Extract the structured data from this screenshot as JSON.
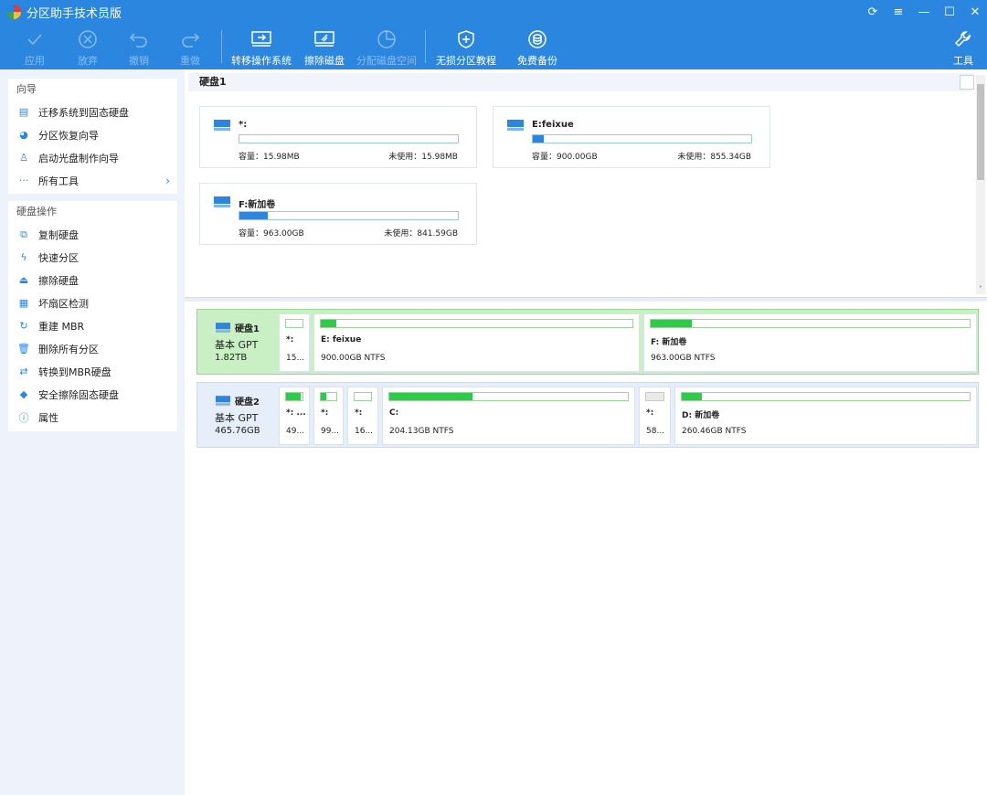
{
  "window": {
    "title": "分区助手技术员版"
  },
  "toolbar": {
    "apply": "应用",
    "discard": "放弃",
    "undo": "撤销",
    "redo": "重做",
    "migrate": "转移操作系统",
    "wipe": "擦除磁盘",
    "allocate": "分配磁盘空间",
    "tutorial": "无损分区教程",
    "backup": "免费备份",
    "tools": "工具"
  },
  "sidebar": {
    "wizard_header": "向导",
    "wizard_items": [
      "迁移系统到固态硬盘",
      "分区恢复向导",
      "启动光盘制作向导",
      "所有工具"
    ],
    "disk_header": "硬盘操作",
    "disk_items": [
      "复制硬盘",
      "快速分区",
      "擦除硬盘",
      "坏扇区检测",
      "重建 MBR",
      "删除所有分区",
      "转换到MBR硬盘",
      "安全擦除固态硬盘",
      "属性"
    ]
  },
  "top_view": {
    "title": "硬盘1",
    "cards": [
      {
        "name": "*:",
        "cap": "容量：15.98MB",
        "free": "未使用：15.98MB",
        "used_pct": 0
      },
      {
        "name": "E:feixue",
        "cap": "容量：900.00GB",
        "free": "未使用：855.34GB",
        "used_pct": 5
      },
      {
        "name": "F:新加卷",
        "cap": "容量：963.00GB",
        "free": "未使用：841.59GB",
        "used_pct": 13
      }
    ]
  },
  "disks": [
    {
      "name": "硬盘1",
      "type": "基本 GPT",
      "size": "1.82TB",
      "partitions": [
        {
          "name": "*:",
          "desc": "15...",
          "used_pct": 0,
          "grey": false
        },
        {
          "name": "E: feixue",
          "desc": "900.00GB NTFS",
          "used_pct": 5,
          "grey": false
        },
        {
          "name": "F: 新加卷",
          "desc": "963.00GB NTFS",
          "used_pct": 13,
          "grey": false
        }
      ]
    },
    {
      "name": "硬盘2",
      "type": "基本 GPT",
      "size": "465.76GB",
      "partitions": [
        {
          "name": "*: ...",
          "desc": "49...",
          "used_pct": 90,
          "grey": false
        },
        {
          "name": "*:",
          "desc": "99...",
          "used_pct": 35,
          "grey": false
        },
        {
          "name": "*:",
          "desc": "16...",
          "used_pct": 0,
          "grey": false
        },
        {
          "name": "C:",
          "desc": "204.13GB NTFS",
          "used_pct": 35,
          "grey": false
        },
        {
          "name": "*:",
          "desc": "58...",
          "used_pct": 0,
          "grey": true
        },
        {
          "name": "D: 新加卷",
          "desc": "260.46GB NTFS",
          "used_pct": 7,
          "grey": false
        }
      ]
    }
  ],
  "colors": {
    "accent": "#2b86e0",
    "used_green": "#2fca4a",
    "selected_row": "#c9f0c4"
  }
}
